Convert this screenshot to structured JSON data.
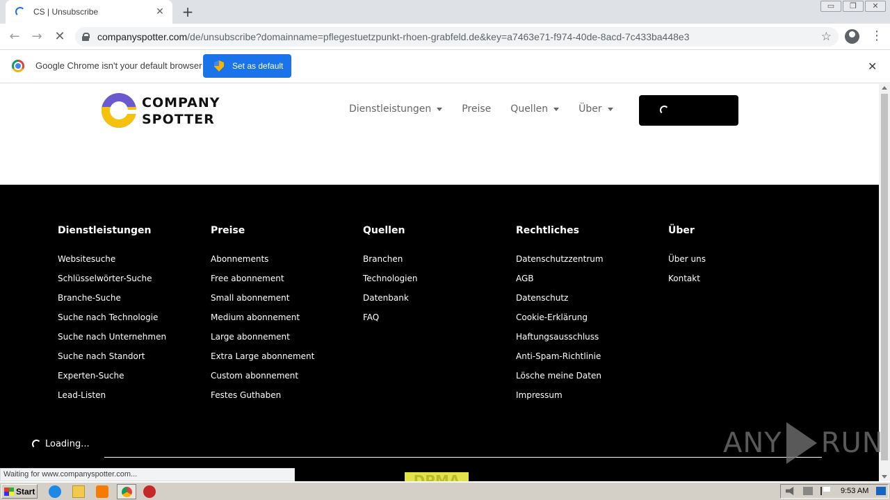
{
  "browser": {
    "tab_title": "CS | Unsubscribe",
    "url_host": "companyspotter.com",
    "url_path": "/de/unsubscribe?domainname=pflegestuetzpunkt-rhoen-grabfeld.de&key=a7463e71-f974-40de-8acd-7c433ba448e3",
    "infobar_text": "Google Chrome isn't your default browser",
    "set_default_label": "Set as default",
    "status_text": "Waiting for www.companyspotter.com..."
  },
  "site": {
    "logo_line1": "COMPANY",
    "logo_line2": "SPOTTER",
    "nav": [
      {
        "label": "Dienstleistungen"
      },
      {
        "label": "Preise"
      },
      {
        "label": "Quellen"
      },
      {
        "label": "Über"
      }
    ]
  },
  "footer": {
    "columns": [
      {
        "heading": "Dienstleistungen",
        "links": [
          "Websitesuche",
          "Schlüsselwörter-Suche",
          "Branche-Suche",
          "Suche nach Technologie",
          "Suche nach Unternehmen",
          "Suche nach Standort",
          "Experten-Suche",
          "Lead-Listen"
        ]
      },
      {
        "heading": "Preise",
        "links": [
          "Abonnements",
          "Free abonnement",
          "Small abonnement",
          "Medium abonnement",
          "Large abonnement",
          "Extra Large abonnement",
          "Custom abonnement",
          "Festes Guthaben"
        ]
      },
      {
        "heading": "Quellen",
        "links": [
          "Branchen",
          "Technologien",
          "Datenbank",
          "FAQ"
        ]
      },
      {
        "heading": "Rechtliches",
        "links": [
          "Datenschutzzentrum",
          "AGB",
          "Datenschutz",
          "Cookie-Erklärung",
          "Haftungsausschluss",
          "Anti-Spam-Richtlinie",
          "Lösche meine Daten",
          "Impressum"
        ]
      },
      {
        "heading": "Über",
        "links": [
          "Über uns",
          "Kontakt"
        ]
      }
    ],
    "loading_text": "Loading...",
    "badge_text": "DPMA"
  },
  "watermark": {
    "left": "ANY",
    "right": "RUN"
  },
  "taskbar": {
    "start_label": "Start",
    "clock": "9:53 AM"
  }
}
